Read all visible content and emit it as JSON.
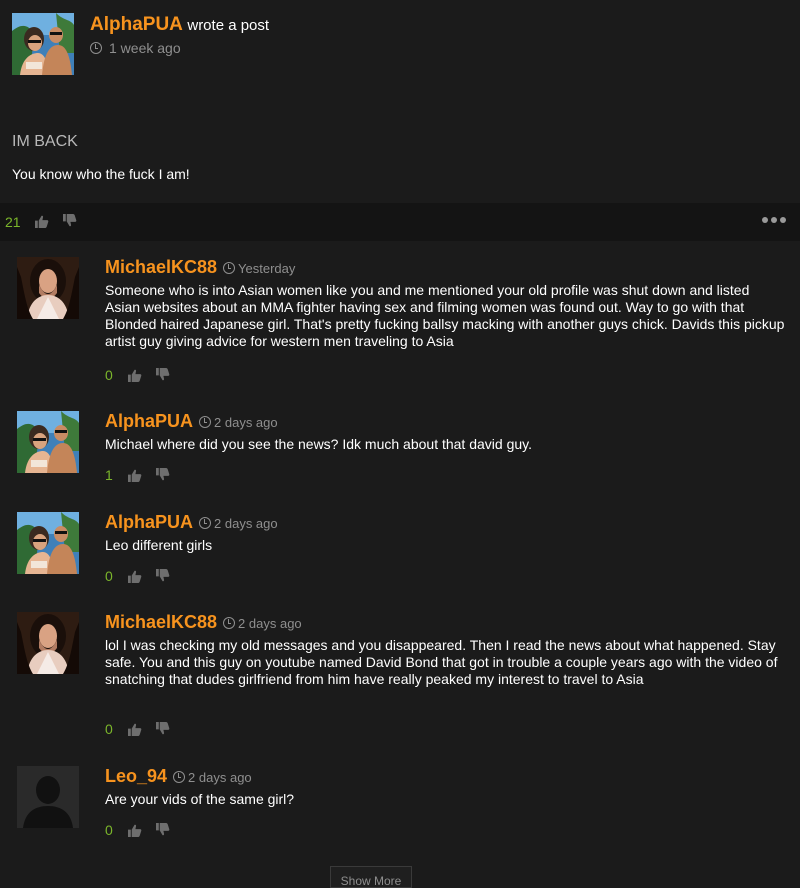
{
  "post": {
    "author": "AlphaPUA",
    "action": "wrote a post",
    "time": "1 week ago",
    "title": "IM BACK",
    "body": "You know who the fuck I am!",
    "votes": "21"
  },
  "comments": [
    {
      "author": "MichaelKC88",
      "time": "Yesterday",
      "text": "Someone who is into Asian women like you and me mentioned your old profile was shut down and listed Asian websites about an MMA fighter having sex and filming women was found out. Way to go with that Blonded haired Japanese girl. That's pretty fucking ballsy macking with another guys chick. Davids this pickup artist guy giving advice for western men traveling to Asia",
      "votes": "0"
    },
    {
      "author": "AlphaPUA",
      "time": "2 days ago",
      "text": "Michael where did you see the news? Idk much about that david guy.",
      "votes": "1"
    },
    {
      "author": "AlphaPUA",
      "time": "2 days ago",
      "text": "Leo different girls",
      "votes": "0"
    },
    {
      "author": "MichaelKC88",
      "time": "2 days ago",
      "text": "lol I was checking my old messages and you disappeared. Then I read the news about what happened. Stay safe. You and this guy on youtube named David Bond that got in trouble a couple years ago with the video of snatching that dudes girlfriend from him have really peaked my interest to travel to Asia",
      "votes": "0"
    },
    {
      "author": "Leo_94",
      "time": "2 days ago",
      "text": "Are your vids of the same girl?",
      "votes": "0"
    }
  ],
  "show_more_label": "Show More",
  "colors": {
    "accent": "#f7931e",
    "vote_positive": "#7bb62b",
    "background": "#1b1b1b"
  },
  "icons": {
    "clock": "clock-icon",
    "like": "thumbs-up-icon",
    "dislike": "thumbs-down-icon",
    "more": "more-options-icon"
  }
}
